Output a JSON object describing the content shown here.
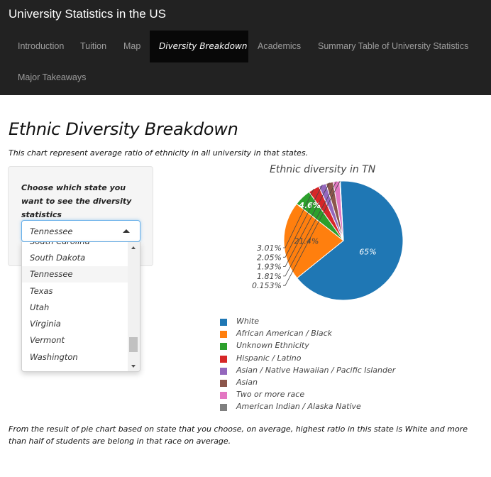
{
  "app": {
    "title": "University Statistics in the US"
  },
  "nav": {
    "tabs": [
      {
        "label": "Introduction"
      },
      {
        "label": "Tuition"
      },
      {
        "label": "Map"
      },
      {
        "label": "Diversity Breakdown"
      },
      {
        "label": "Academics"
      },
      {
        "label": "Summary Table of University Statistics"
      },
      {
        "label": "Major Takeaways"
      }
    ],
    "active": "Diversity Breakdown"
  },
  "main": {
    "title": "Ethnic Diversity Breakdown",
    "subtitle": "This chart represent average ratio of ethnicity in all university in that states.",
    "conclusion": "From the result of pie chart based on state that you choose, on average, highest ratio in this state is White and more than half of students are belong in that race on average."
  },
  "state_select": {
    "label": "Choose which state you want to see the diversity statistics",
    "value": "Tennessee",
    "visible_options": [
      "South Carolina",
      "South Dakota",
      "Tennessee",
      "Texas",
      "Utah",
      "Virginia",
      "Vermont",
      "Washington"
    ]
  },
  "chart_data": {
    "type": "pie",
    "title": "Ethnic diversity in TN",
    "labels": [
      "White",
      "African American / Black",
      "Unknown Ethnicity",
      "Hispanic / Latino",
      "Asian / Native Hawaiian / Pacific Islander",
      "Asian",
      "Two or more race",
      "American Indian / Alaska Native"
    ],
    "values": [
      65,
      21.4,
      4.6,
      3.01,
      2.05,
      1.93,
      1.81,
      0.153
    ],
    "value_labels": [
      "65%",
      "21.4%",
      "4.6%",
      "3.01%",
      "2.05%",
      "1.93%",
      "1.81%",
      "0.153%"
    ],
    "colors": [
      "#1f77b4",
      "#ff7f0e",
      "#2ca02c",
      "#d62728",
      "#9467bd",
      "#8c564b",
      "#e377c2",
      "#7f7f7f"
    ],
    "legend_position": "bottom"
  }
}
